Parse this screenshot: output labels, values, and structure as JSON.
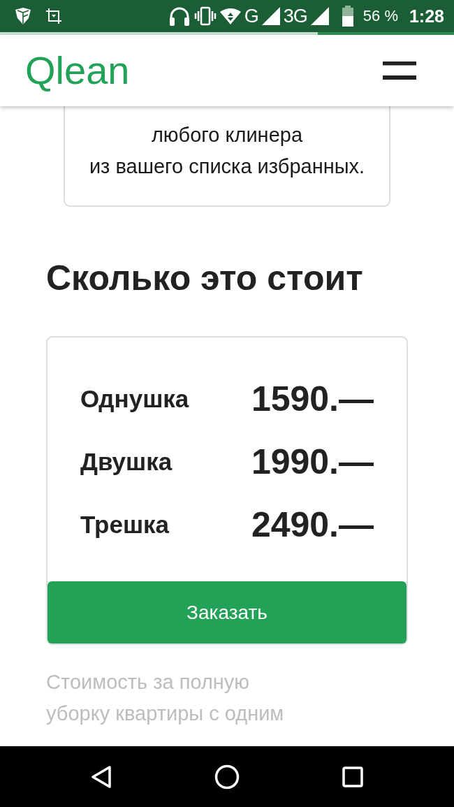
{
  "status_bar": {
    "networks": [
      "G",
      "3G"
    ],
    "battery": "56 %",
    "time": "1:28"
  },
  "load_progress": {
    "level": 0.7
  },
  "header": {
    "logo": "Qlean"
  },
  "feature_card": {
    "lines": [
      "любого клинера",
      "из вашего списка избранных."
    ]
  },
  "pricing": {
    "title": "Сколько это стоит",
    "plans": [
      {
        "name": "Однушка",
        "price": "1590.—"
      },
      {
        "name": "Двушка",
        "price": "1990.—"
      },
      {
        "name": "Трешка",
        "price": "2490.—"
      }
    ],
    "button": "Заказать",
    "note": "Стоимость за полную уборку квартиры с одним"
  }
}
